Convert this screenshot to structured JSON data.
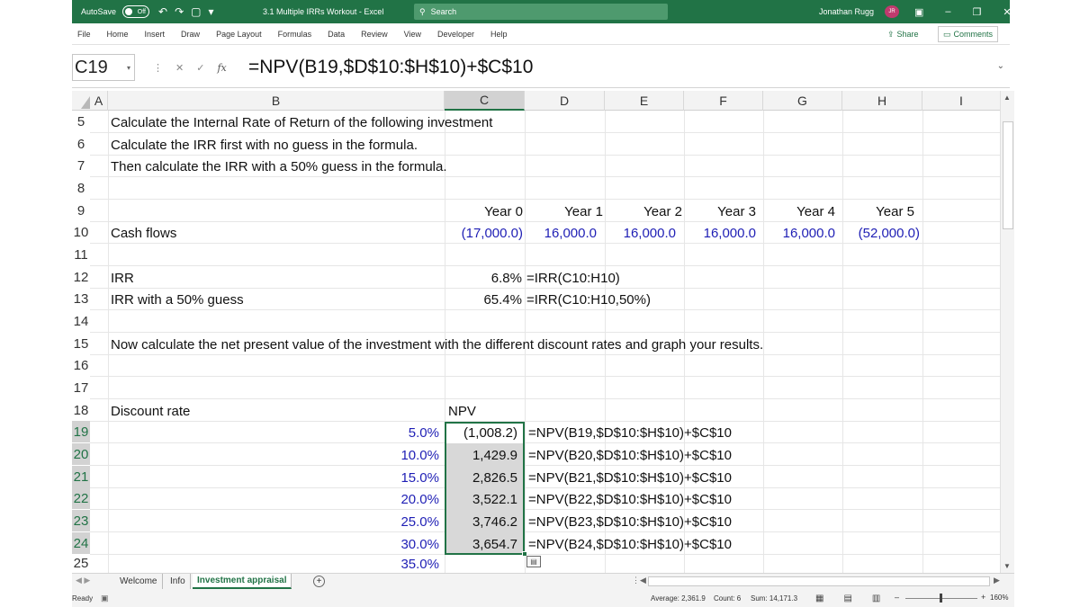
{
  "titlebar": {
    "autosave_label": "AutoSave",
    "autosave_state": "Off",
    "document_title": "3.1 Multiple IRRs Workout  -  Excel",
    "search_placeholder": "Search",
    "user_name": "Jonathan Rugg",
    "user_initials": "JR"
  },
  "ribbon": {
    "tabs": [
      "File",
      "Home",
      "Insert",
      "Draw",
      "Page Layout",
      "Formulas",
      "Data",
      "Review",
      "View",
      "Developer",
      "Help"
    ],
    "share_label": "Share",
    "comments_label": "Comments"
  },
  "formula_bar": {
    "name_box": "C19",
    "formula": "=NPV(B19,$D$10:$H$10)+$C$10"
  },
  "columns": [
    "A",
    "B",
    "C",
    "D",
    "E",
    "F",
    "G",
    "H",
    "I"
  ],
  "active_column": "C",
  "rows": [
    "5",
    "6",
    "7",
    "8",
    "9",
    "10",
    "11",
    "12",
    "13",
    "14",
    "15",
    "16",
    "17",
    "18",
    "19",
    "20",
    "21",
    "22",
    "23",
    "24",
    "25"
  ],
  "sheet": {
    "instructions": [
      "Calculate the Internal Rate of Return of the following investment",
      "Calculate the IRR first with no guess in the formula.",
      "Then calculate the IRR with a 50% guess in the formula."
    ],
    "years": [
      "Year 0",
      "Year 1",
      "Year 2",
      "Year 3",
      "Year 4",
      "Year 5"
    ],
    "cash_flows_label": "Cash flows",
    "cash_flows": [
      "(17,000.0)",
      "16,000.0",
      "16,000.0",
      "16,000.0",
      "16,000.0",
      "(52,000.0)"
    ],
    "irr_label": "IRR",
    "irr_value": "6.8%",
    "irr_formula": "=IRR(C10:H10)",
    "irr_guess_label": "IRR with a 50% guess",
    "irr_guess_value": "65.4%",
    "irr_guess_formula": "=IRR(C10:H10,50%)",
    "npv_instruction": "Now calculate the net present value of the investment with the different discount rates and graph your results.",
    "discount_rate_label": "Discount rate",
    "npv_label": "NPV",
    "discount_rows": [
      {
        "rate": "5.0%",
        "npv": "(1,008.2)",
        "formula": "=NPV(B19,$D$10:$H$10)+$C$10"
      },
      {
        "rate": "10.0%",
        "npv": "1,429.9",
        "formula": "=NPV(B20,$D$10:$H$10)+$C$10"
      },
      {
        "rate": "15.0%",
        "npv": "2,826.5",
        "formula": "=NPV(B21,$D$10:$H$10)+$C$10"
      },
      {
        "rate": "20.0%",
        "npv": "3,522.1",
        "formula": "=NPV(B22,$D$10:$H$10)+$C$10"
      },
      {
        "rate": "25.0%",
        "npv": "3,746.2",
        "formula": "=NPV(B23,$D$10:$H$10)+$C$10"
      },
      {
        "rate": "30.0%",
        "npv": "3,654.7",
        "formula": "=NPV(B24,$D$10:$H$10)+$C$10"
      },
      {
        "rate": "35.0%",
        "npv": "",
        "formula": ""
      }
    ]
  },
  "sheet_tabs": [
    "Welcome",
    "Info",
    "Investment appraisal"
  ],
  "active_sheet": "Investment appraisal",
  "status": {
    "ready": "Ready",
    "average": "Average: 2,361.9",
    "count": "Count: 6",
    "sum": "Sum: 14,171.3",
    "zoom": "160%"
  },
  "colors": {
    "excel_green": "#217346",
    "input_blue": "#1f1fb5",
    "selection_gray": "#d8d8d8"
  }
}
